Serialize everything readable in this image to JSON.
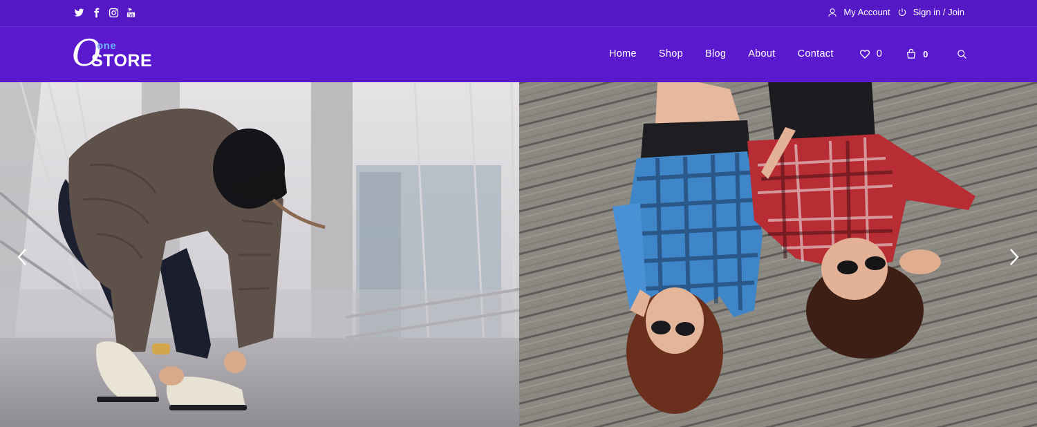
{
  "topbar": {
    "social": [
      "twitter-icon",
      "facebook-icon",
      "instagram-icon",
      "youtube-icon"
    ],
    "my_account": "My Account",
    "sign_in": "Sign in / Join"
  },
  "logo": {
    "one": "one",
    "store": "STORE"
  },
  "nav": {
    "items": [
      "Home",
      "Shop",
      "Blog",
      "About",
      "Contact"
    ],
    "wishlist_count": "0",
    "cart_count": "0"
  },
  "hero": {
    "slides": [
      {
        "description": "Woman in puffer jacket and beanie tying sneaker laces on a bridge"
      },
      {
        "description": "Two women in plaid shirts and sunglasses lying on a wooden deck"
      }
    ]
  },
  "colors": {
    "topbar": "#5418c4",
    "mainbar": "#5b19cf",
    "logo_accent": "#6fb3ff",
    "text": "#ffffff"
  }
}
